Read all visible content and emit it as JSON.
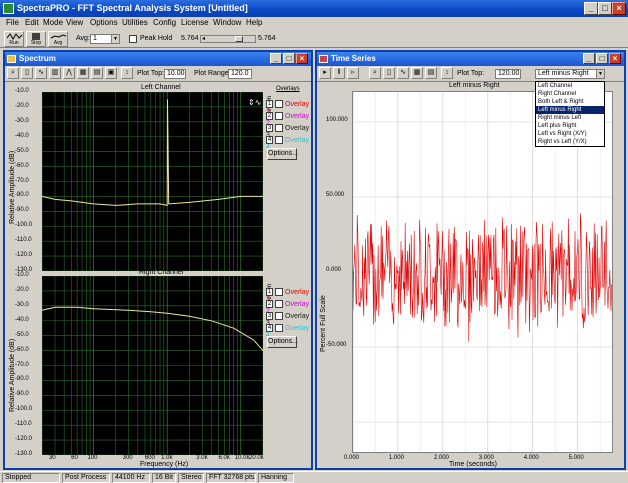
{
  "app": {
    "title": "SpectraPRO - FFT Spectral Analysis System [Untitled]",
    "window_buttons": [
      "_",
      "□",
      "×"
    ]
  },
  "menu": [
    "File",
    "Edit",
    "Mode",
    "View",
    "Options",
    "Utilities",
    "Config",
    "License",
    "Window",
    "Help"
  ],
  "toolbar": {
    "run_label": "Run",
    "stop_label": "Stop",
    "avg_icon_label": "Avg",
    "avg_label": "Avg:",
    "avg_value": "1",
    "peak_hold_label": "Peak Hold",
    "slider_left_value": "5.764",
    "slider_right_value": "5.764"
  },
  "spectrum": {
    "title": "Spectrum",
    "plot_top_label": "Plot Top:",
    "plot_top_value": "10.00",
    "plot_range_label": "Plot Range:",
    "plot_range_value": "120.0",
    "ylabel": "Relative Amplitude (dB)",
    "xlabel": "Frequency (Hz)",
    "left_channel_title": "Left Channel",
    "right_channel_title": "Right Channel",
    "y_ticks": [
      "-10.0",
      "-20.0",
      "-30.0",
      "-40.0",
      "-50.0",
      "-60.0",
      "-70.0",
      "-80.0",
      "-90.0",
      "-100.0",
      "-110.0",
      "-120.0",
      "-130.0"
    ],
    "x_ticks": [
      "30",
      "60",
      "100",
      "300",
      "600",
      "1.0k",
      "3.0k",
      "6.0k",
      "10.0k",
      "20.0k"
    ],
    "overlays_label": "Overlays",
    "overlays_on": "On",
    "overlay_items": [
      {
        "num": "1",
        "label": "Overlay 1",
        "color": "#e00000"
      },
      {
        "num": "2",
        "label": "Overlay 2",
        "color": "#d000d0"
      },
      {
        "num": "3",
        "label": "Overlay 3",
        "color": "#202020"
      },
      {
        "num": "4",
        "label": "Overlay 4",
        "color": "#30c0d0"
      }
    ],
    "options_label": "Options...",
    "ref_label": "Ref"
  },
  "timeseries": {
    "title": "Time Series",
    "plot_top_label": "Plot Top:",
    "plot_top_value": "120.00",
    "mode_value": "Left minus Right",
    "plot_title": "Left minus Right",
    "ylabel": "Percent Full Scale",
    "xlabel": "Time (seconds)",
    "y_ticks": [
      "100.000",
      "50.000",
      "0.000",
      "-50.000"
    ],
    "x_ticks": [
      "0.000",
      "1.000",
      "2.000",
      "3.000",
      "4.000",
      "5.000"
    ],
    "mode_options": [
      "Left Channel",
      "Right Channel",
      "Both Left & Right",
      "Left minus Right",
      "Right minus Left",
      "Left plus Right",
      "Left vs Right (X/Y)",
      "Right vs Left (Y/X)"
    ],
    "selected_index": 3
  },
  "status": [
    "Stopped",
    "Post Process",
    "44100 Hz",
    "16 Bit",
    "Stereo",
    "FFT 32768 pts",
    "Hanning"
  ],
  "chart_data": [
    {
      "type": "line",
      "title": "Left Channel",
      "xlabel": "Frequency (Hz)",
      "ylabel": "Relative Amplitude (dB)",
      "x_scale": "log",
      "xlim": [
        20,
        20000
      ],
      "ylim": [
        -130,
        -10
      ],
      "series": [
        {
          "x": [
            20,
            30,
            50,
            100,
            200,
            400,
            800,
            1000,
            1010,
            1050,
            2000,
            5000,
            10000,
            20000
          ],
          "values": [
            -80,
            -82,
            -83,
            -85,
            -86,
            -85,
            -85,
            -86,
            -15,
            -85,
            -84,
            -82,
            -80,
            -80
          ]
        }
      ]
    },
    {
      "type": "line",
      "title": "Right Channel",
      "xlabel": "Frequency (Hz)",
      "ylabel": "Relative Amplitude (dB)",
      "x_scale": "log",
      "xlim": [
        20,
        20000
      ],
      "ylim": [
        -130,
        -10
      ],
      "series": [
        {
          "x": [
            20,
            30,
            60,
            100,
            300,
            600,
            1000,
            2000,
            4000,
            8000,
            15000,
            20000
          ],
          "values": [
            -33,
            -31,
            -31,
            -32,
            -33,
            -34,
            -35,
            -37,
            -40,
            -45,
            -53,
            -60
          ]
        }
      ]
    },
    {
      "type": "line",
      "title": "Left minus Right",
      "xlabel": "Time (seconds)",
      "ylabel": "Percent Full Scale",
      "xlim": [
        0,
        5.764
      ],
      "ylim": [
        -120,
        120
      ],
      "series": [
        {
          "x": [
            0,
            5.764
          ],
          "values": [
            0,
            0
          ]
        }
      ]
    }
  ]
}
